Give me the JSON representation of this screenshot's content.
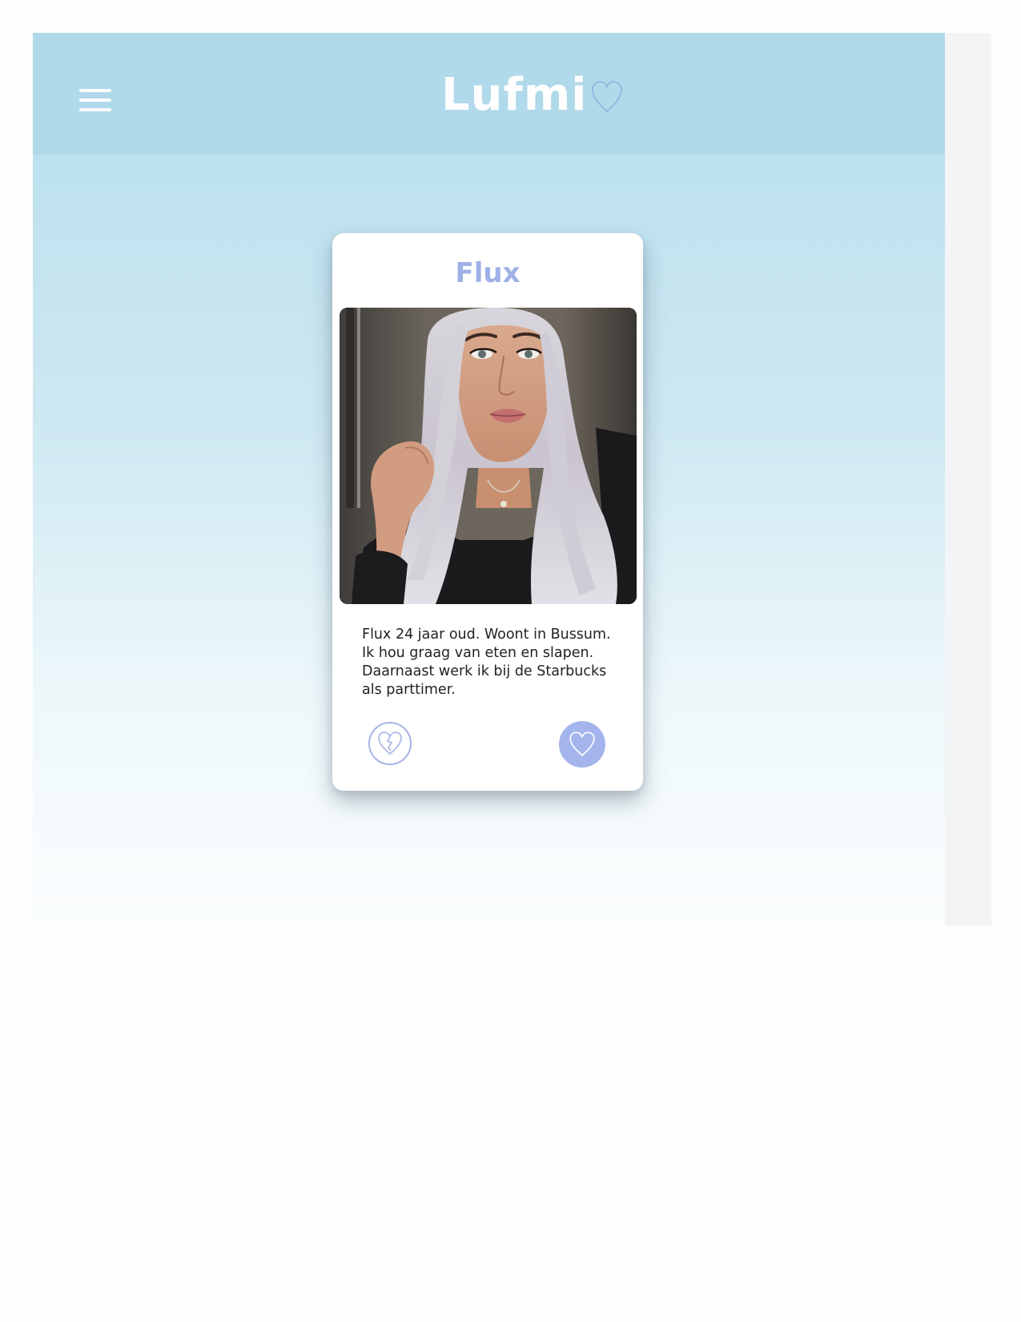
{
  "app": {
    "logo_text": "Lufmi",
    "menu_icon": "hamburger-menu-icon",
    "logo_icon": "heart-outline-icon"
  },
  "profile": {
    "name": "Flux",
    "photo_alt": "Flux",
    "bio": "Flux 24 jaar oud. Woont in Bussum. Ik hou graag van eten en slapen. Daarnaast werk ik bij de Starbucks als parttimer.",
    "actions": {
      "dislike_icon": "broken-heart-icon",
      "like_icon": "heart-icon"
    }
  },
  "colors": {
    "header_bg": "#b0d9ea",
    "accent": "#a3b5ec",
    "name_color": "#9eb0e6"
  }
}
